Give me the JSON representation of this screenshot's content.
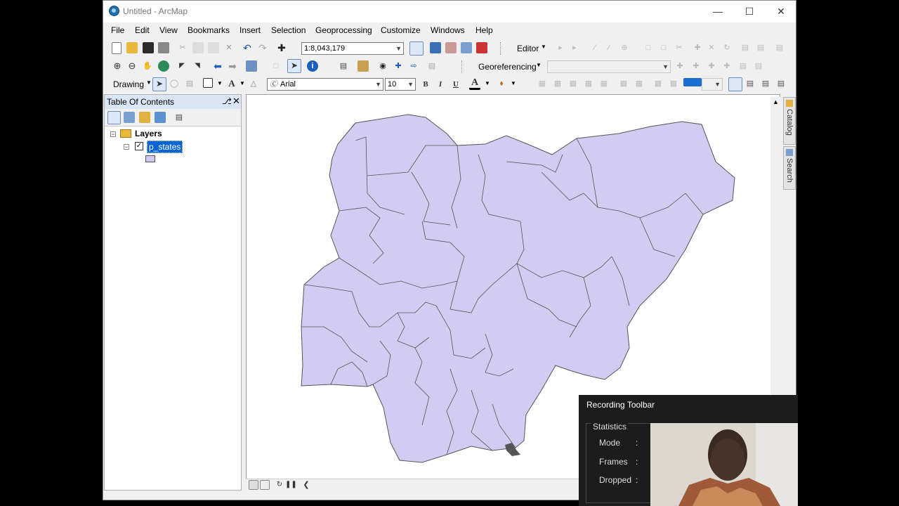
{
  "window": {
    "title": "Untitled - ArcMap"
  },
  "menu": [
    "File",
    "Edit",
    "View",
    "Bookmarks",
    "Insert",
    "Selection",
    "Geoprocessing",
    "Customize",
    "Windows",
    "Help"
  ],
  "toolbar": {
    "scale_value": "1:8,043,179",
    "editor_label": "Editor",
    "georeferencing_label": "Georeferencing",
    "drawing_label": "Drawing",
    "font_name": "Arial",
    "font_size": "10",
    "bold": "B",
    "italic": "I",
    "underline": "U"
  },
  "toc": {
    "title": "Table Of Contents",
    "root_label": "Layers",
    "layer_name": "p_states",
    "layer_checked": true,
    "symbol_color": "#cfc8f0"
  },
  "map": {
    "fill_color": "#d2ccf2",
    "border_color": "#555555"
  },
  "side_tabs": [
    "Catalog",
    "Search"
  ],
  "recording": {
    "title": "Recording Toolbar",
    "group_title": "Statistics",
    "rows": [
      {
        "label": "Mode",
        "value": ":"
      },
      {
        "label": "Frames",
        "value": ":"
      },
      {
        "label": "Dropped",
        "value": ":"
      }
    ]
  }
}
